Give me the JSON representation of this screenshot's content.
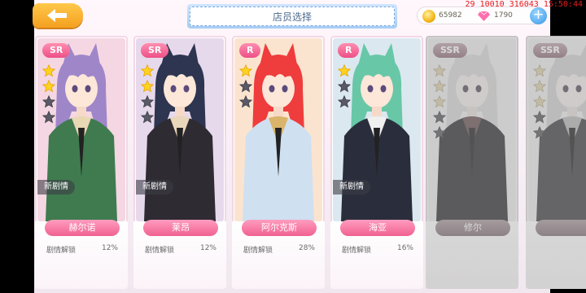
{
  "header": {
    "title": "店员选择",
    "coins": "65982",
    "gems": "1790"
  },
  "debug": "29 10010 316043 15:50:44",
  "cards": [
    {
      "rank": "SR",
      "stars": 2,
      "new_story": "新剧情",
      "name": "赫尔诺",
      "unlock_label": "剧情解锁",
      "unlock_pct": "12%",
      "locked": false,
      "colors": {
        "bg": "#f4d7e2",
        "hair": "#9f86c9",
        "coat": "#3f7b4f",
        "accent": "#e9d8b4"
      }
    },
    {
      "rank": "SR",
      "stars": 2,
      "new_story": "新剧情",
      "name": "莱昂",
      "unlock_label": "剧情解锁",
      "unlock_pct": "12%",
      "locked": false,
      "colors": {
        "bg": "#e7d9ec",
        "hair": "#2d3550",
        "coat": "#2f2b33",
        "accent": "#ead7bb"
      }
    },
    {
      "rank": "R",
      "stars": 1,
      "new_story": "",
      "name": "阿尔克斯",
      "unlock_label": "剧情解锁",
      "unlock_pct": "28%",
      "locked": false,
      "colors": {
        "bg": "#fbe4cf",
        "hair": "#ef3c3c",
        "coat": "#cfe0f1",
        "accent": "#d9b46a"
      }
    },
    {
      "rank": "R",
      "stars": 1,
      "new_story": "新剧情",
      "name": "海亚",
      "unlock_label": "剧情解锁",
      "unlock_pct": "16%",
      "locked": false,
      "colors": {
        "bg": "#dbe8f0",
        "hair": "#68c7a7",
        "coat": "#2a2e3c",
        "accent": "#f0f0f0"
      }
    },
    {
      "rank": "SSR",
      "stars": 3,
      "new_story": "",
      "name": "修尔",
      "unlock_label": "",
      "unlock_pct": "",
      "locked": true,
      "colors": {
        "bg": "#ececec",
        "hair": "#d6d6d6",
        "coat": "#2c2f3f",
        "accent": "#b83a49"
      }
    },
    {
      "rank": "SSR",
      "stars": 3,
      "new_story": "",
      "name": "",
      "unlock_label": "",
      "unlock_pct": "",
      "locked": true,
      "colors": {
        "bg": "#ececec",
        "hair": "#cfcfcf",
        "coat": "#3b3f4f",
        "accent": "#b7b7b7"
      }
    }
  ]
}
